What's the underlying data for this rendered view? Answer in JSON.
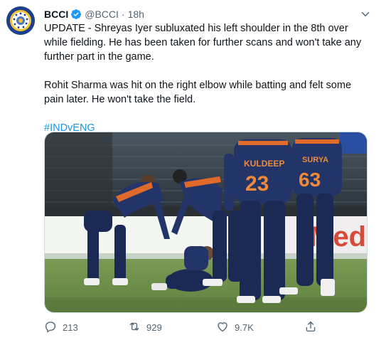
{
  "author": {
    "name": "BCCI",
    "handle": "@BCCI",
    "separator": "·",
    "time": "18h"
  },
  "body": {
    "paragraph_1": "UPDATE - Shreyas Iyer subluxated his left shoulder in the 8th over while fielding. He has been taken for further scans and won't take any further part in the game.",
    "paragraph_2": "Rohit Sharma was hit on the right elbow while batting and felt some pain later. He won't take the field.",
    "hashtag": "#INDvENG"
  },
  "media": {
    "jersey_1": "KULDEEP",
    "jersey_1_number": "23",
    "jersey_2": "SURYA",
    "jersey_2_number": "63",
    "board_text": "Med"
  },
  "actions": {
    "replies": "213",
    "retweets": "929",
    "likes": "9.7K"
  },
  "icons": {
    "verified": "verified-badge-icon",
    "more": "more-options-icon",
    "reply": "reply-icon",
    "retweet": "retweet-icon",
    "like": "heart-icon",
    "share": "share-icon"
  },
  "colors": {
    "accent": "#1d9bf0",
    "hashtag": "#1b95e0",
    "muted": "#536471"
  }
}
